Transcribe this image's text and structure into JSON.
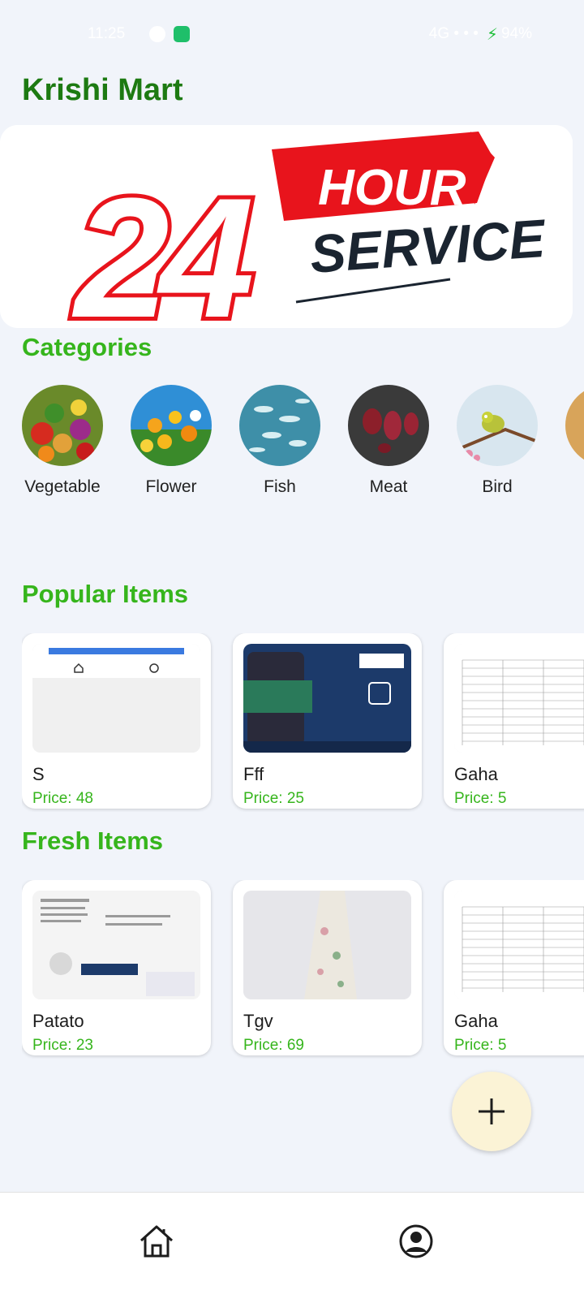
{
  "status_bar": {
    "time": "11:25",
    "system_icons": "4G • • •",
    "battery": "94%"
  },
  "app": {
    "title": "Krishi Mart"
  },
  "banner": {
    "number": "24",
    "word1": "HOUR",
    "word2": "SERVICE"
  },
  "categories": {
    "title": "Categories",
    "items": [
      {
        "label": "Vegetable",
        "icon": "vegetable-image"
      },
      {
        "label": "Flower",
        "icon": "flower-image"
      },
      {
        "label": "Fish",
        "icon": "fish-image"
      },
      {
        "label": "Meat",
        "icon": "meat-image"
      },
      {
        "label": "Bird",
        "icon": "bird-image"
      }
    ]
  },
  "popular": {
    "title": "Popular Items",
    "items": [
      {
        "name": "S",
        "price": "48"
      },
      {
        "name": "Fff",
        "price": "25"
      },
      {
        "name": "Gaha",
        "price": "5"
      }
    ]
  },
  "fresh": {
    "title": "Fresh Items",
    "items": [
      {
        "name": "Patato",
        "price": "23"
      },
      {
        "name": "Tgv",
        "price": "69"
      },
      {
        "name": "Gaha",
        "price": "5"
      }
    ]
  },
  "price_prefix": "Price: ",
  "colors": {
    "brand_green": "#1d7a12",
    "accent_green": "#36b51c",
    "background": "#f1f4fa",
    "fab": "#fbf3d6"
  },
  "nav": {
    "home_icon": "home-icon",
    "profile_icon": "account-circle-icon"
  }
}
